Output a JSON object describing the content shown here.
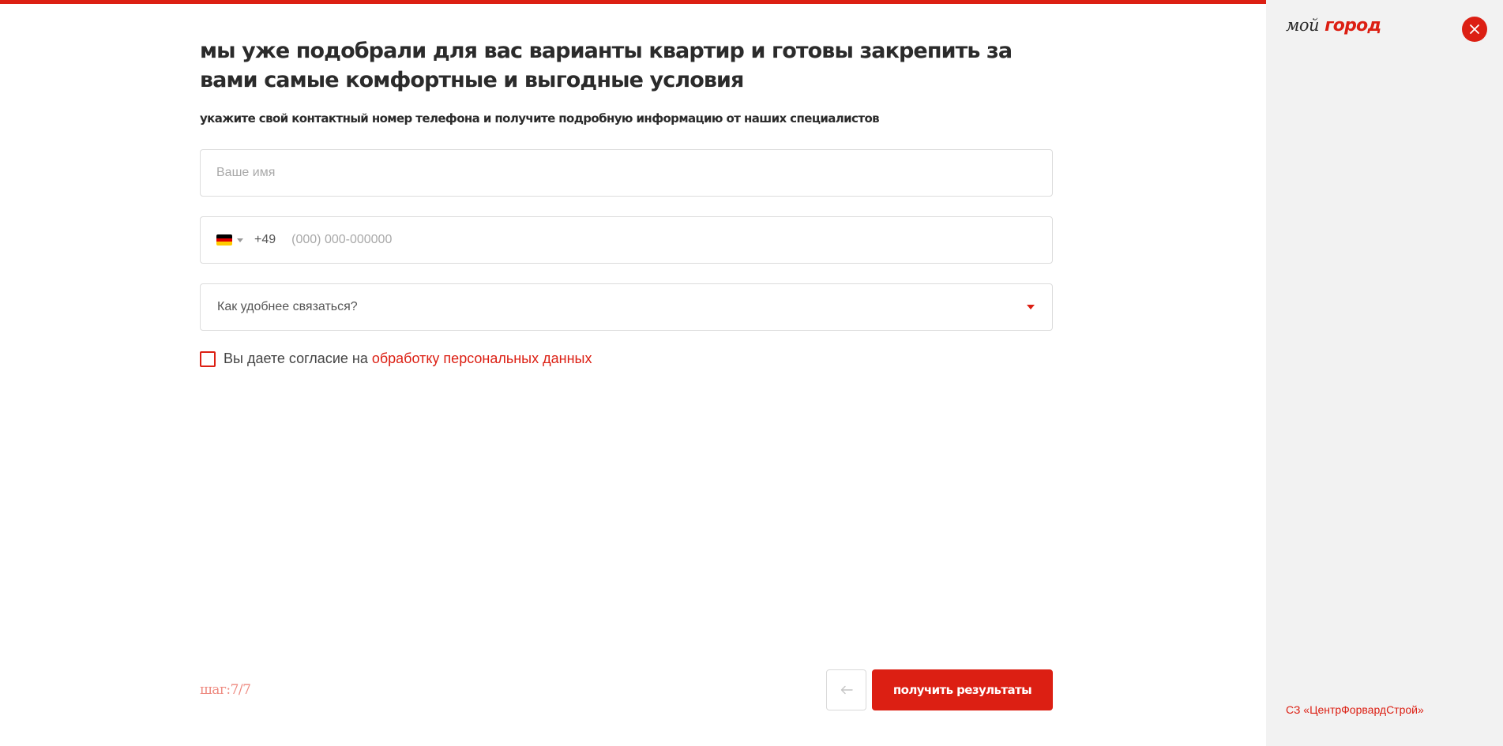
{
  "progress": {
    "value": 1.0,
    "color": "#dc1f13"
  },
  "form": {
    "title": "мы уже подобрали для вас варианты квартир и готовы закрепить за вами самые комфортные и выгодные условия",
    "subtitle": "укажите свой контактный номер телефона и получите подробную информацию от наших специалистов",
    "name_placeholder": "Ваше имя",
    "phone": {
      "country_icon": "germany-flag-icon",
      "dial_code": "+49",
      "placeholder": "(000) 000-000000"
    },
    "contact_method_placeholder": "Как удобнее связаться?",
    "consent": {
      "text": "Вы даете согласие на",
      "link_text": "обработку персональных данных",
      "checked": false
    }
  },
  "footer": {
    "step_text": "шаг:7/7",
    "back_icon": "arrow-left-icon",
    "submit_label": "получить результаты"
  },
  "sidebar": {
    "logo_part1": "мой",
    "logo_part2": "город",
    "close_icon": "close-icon",
    "company": "СЗ «ЦентрФорвардСтрой»"
  },
  "colors": {
    "accent": "#dc1f13",
    "sidebar_bg": "#f2f2f2",
    "text": "#2b2b2b"
  }
}
